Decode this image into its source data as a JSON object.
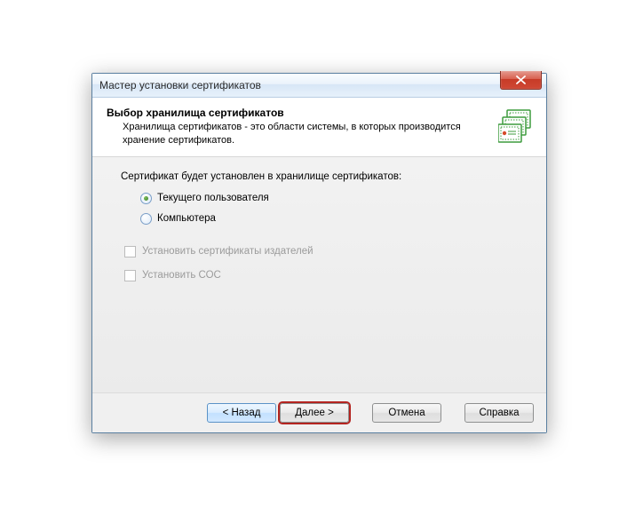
{
  "title": "Мастер установки сертификатов",
  "header": {
    "title": "Выбор хранилища сертификатов",
    "desc": "Хранилища сертификатов - это области системы, в которых производится хранение сертификатов."
  },
  "body": {
    "instruction": "Сертификат будет установлен в хранилище сертификатов:",
    "radio": {
      "current_user": "Текущего пользователя",
      "computer": "Компьютера"
    },
    "check": {
      "publishers": "Установить сертификаты издателей",
      "crl": "Установить СОС"
    }
  },
  "buttons": {
    "back": "< Назад",
    "next": "Далее >",
    "cancel": "Отмена",
    "help": "Справка"
  }
}
